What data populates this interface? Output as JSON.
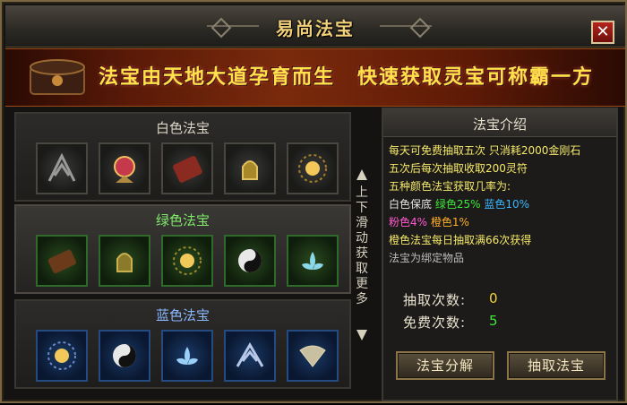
{
  "window": {
    "title": "易尚法宝",
    "close_label": "✕"
  },
  "banner": {
    "text_left": "法宝由天地大道孕育而生",
    "text_right": "快速获取灵宝可称霸一方"
  },
  "sections": {
    "white": {
      "title": "白色法宝"
    },
    "green": {
      "title": "绿色法宝"
    },
    "blue": {
      "title": "蓝色法宝"
    }
  },
  "scroll_hint": {
    "text": "上下滑动获取更多"
  },
  "intro": {
    "title": "法宝介绍",
    "line1": "每天可免费抽取五次 只消耗2000金刚石",
    "line2": "五次后每次抽取收取200灵符",
    "line3": "五种颜色法宝获取几率为:",
    "line4_label": "白色保底",
    "green_rate": "绿色25%",
    "blue_rate": "蓝色10%",
    "pink_rate": "粉色4%",
    "orange_rate": "橙色1%",
    "line6": "橙色法宝每日抽取满66次获得",
    "line7": "法宝为绑定物品"
  },
  "stats": {
    "draw_label": "抽取次数:",
    "draw_count": "0",
    "free_label": "免费次数:",
    "free_count": "5"
  },
  "buttons": {
    "decompose": "法宝分解",
    "draw": "抽取法宝"
  },
  "colors": {
    "gold": "#f2d07a",
    "white_tier": "#d9d4c4",
    "green_tier": "#7fe86a",
    "blue_tier": "#8ab8ff"
  }
}
